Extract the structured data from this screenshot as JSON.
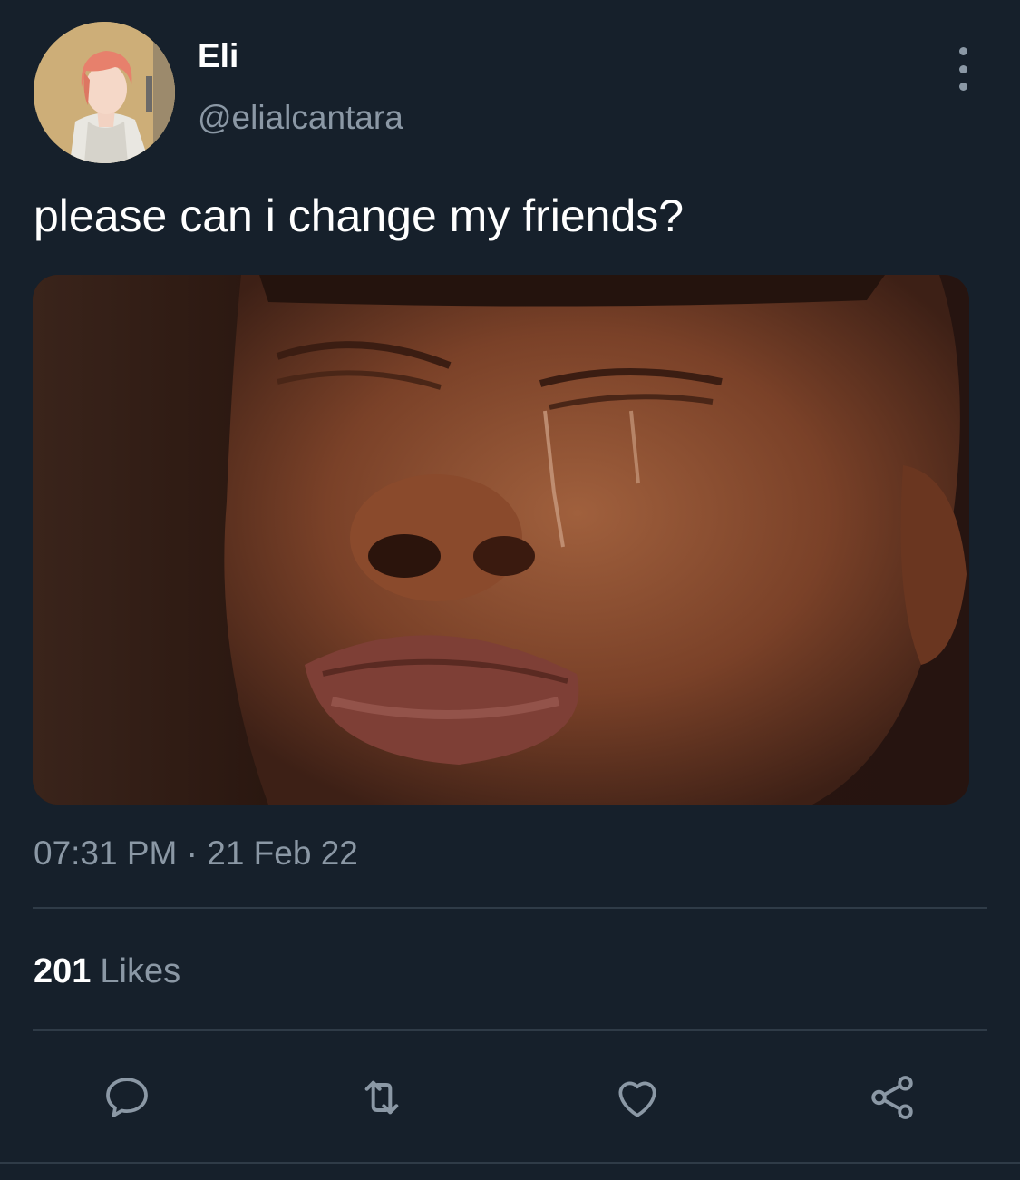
{
  "user": {
    "display_name": "Eli",
    "handle": "@elialcantara",
    "avatar": "profile photo of a person with pink hair in a light jacket"
  },
  "tweet": {
    "text": "please can i change my friends?",
    "media": "close-up photo of a man crying with closed eyes and tears on his cheek",
    "timestamp": "07:31 PM · 21 Feb 22"
  },
  "stats": {
    "likes_count": "201",
    "likes_label": "Likes"
  },
  "actions": {
    "icons": [
      "reply-icon",
      "retweet-icon",
      "like-icon",
      "share-icon"
    ]
  },
  "colors": {
    "background": "#16202b",
    "text_primary": "#ffffff",
    "text_secondary": "#8b98a5",
    "divider": "#2f3b47"
  }
}
